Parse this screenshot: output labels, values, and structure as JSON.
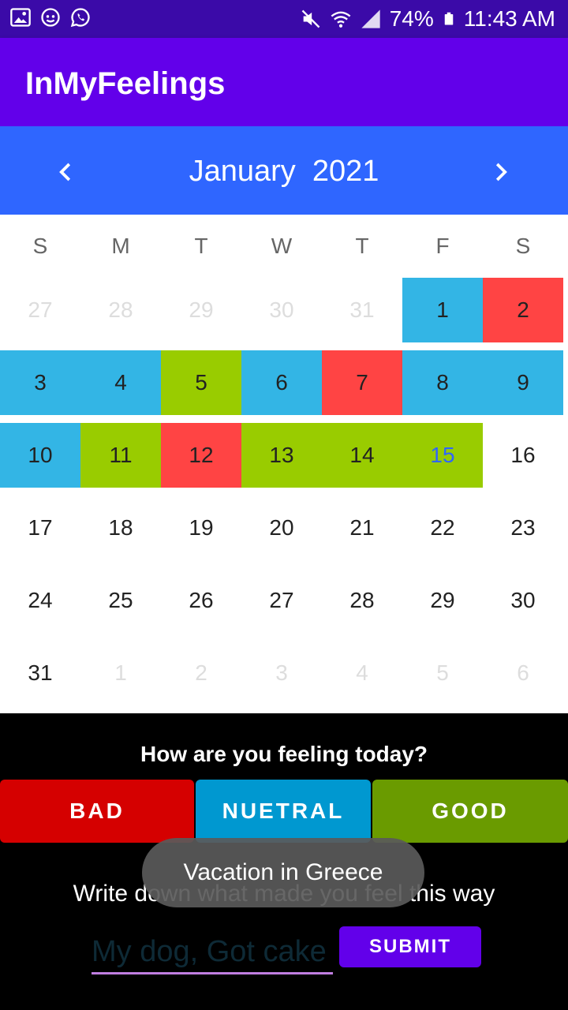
{
  "status_bar": {
    "left_icons": [
      "image-icon",
      "face-icon",
      "whatsapp-icon"
    ],
    "right_icons": [
      "mute-icon",
      "wifi-icon",
      "signal-icon",
      "battery-icon"
    ],
    "battery": "74%",
    "time": "11:43 AM"
  },
  "app_bar": {
    "title": "InMyFeelings"
  },
  "calendar": {
    "month_year": "January  2021",
    "weekdays": [
      "S",
      "M",
      "T",
      "W",
      "T",
      "F",
      "S"
    ],
    "mood_colors": {
      "bad": "#ff4444",
      "neutral": "#33b5e5",
      "good": "#99cc00",
      "today_text": "#2f66ff"
    },
    "days": [
      {
        "label": "27",
        "in_month": false
      },
      {
        "label": "28",
        "in_month": false
      },
      {
        "label": "29",
        "in_month": false
      },
      {
        "label": "30",
        "in_month": false
      },
      {
        "label": "31",
        "in_month": false
      },
      {
        "label": "1",
        "in_month": true,
        "mood": "neutral"
      },
      {
        "label": "2",
        "in_month": true,
        "mood": "bad"
      },
      {
        "label": "3",
        "in_month": true,
        "mood": "neutral"
      },
      {
        "label": "4",
        "in_month": true,
        "mood": "neutral"
      },
      {
        "label": "5",
        "in_month": true,
        "mood": "good"
      },
      {
        "label": "6",
        "in_month": true,
        "mood": "neutral"
      },
      {
        "label": "7",
        "in_month": true,
        "mood": "bad"
      },
      {
        "label": "8",
        "in_month": true,
        "mood": "neutral"
      },
      {
        "label": "9",
        "in_month": true,
        "mood": "neutral"
      },
      {
        "label": "10",
        "in_month": true,
        "mood": "neutral"
      },
      {
        "label": "11",
        "in_month": true,
        "mood": "good"
      },
      {
        "label": "12",
        "in_month": true,
        "mood": "bad"
      },
      {
        "label": "13",
        "in_month": true,
        "mood": "good"
      },
      {
        "label": "14",
        "in_month": true,
        "mood": "good"
      },
      {
        "label": "15",
        "in_month": true,
        "mood": "good",
        "today": true
      },
      {
        "label": "16",
        "in_month": true
      },
      {
        "label": "17",
        "in_month": true
      },
      {
        "label": "18",
        "in_month": true
      },
      {
        "label": "19",
        "in_month": true
      },
      {
        "label": "20",
        "in_month": true
      },
      {
        "label": "21",
        "in_month": true
      },
      {
        "label": "22",
        "in_month": true
      },
      {
        "label": "23",
        "in_month": true
      },
      {
        "label": "24",
        "in_month": true
      },
      {
        "label": "25",
        "in_month": true
      },
      {
        "label": "26",
        "in_month": true
      },
      {
        "label": "27",
        "in_month": true
      },
      {
        "label": "28",
        "in_month": true
      },
      {
        "label": "29",
        "in_month": true
      },
      {
        "label": "30",
        "in_month": true
      },
      {
        "label": "31",
        "in_month": true
      },
      {
        "label": "1",
        "in_month": false
      },
      {
        "label": "2",
        "in_month": false
      },
      {
        "label": "3",
        "in_month": false
      },
      {
        "label": "4",
        "in_month": false
      },
      {
        "label": "5",
        "in_month": false
      },
      {
        "label": "6",
        "in_month": false
      }
    ]
  },
  "mood_panel": {
    "question": "How are you feeling today?",
    "buttons": {
      "bad": "BAD",
      "neutral": "NUETRAL",
      "good": "GOOD"
    },
    "button_colors": {
      "bad": "#d50000",
      "neutral": "#0098d0",
      "good": "#6a9b00"
    },
    "prompt": "Write down what made you feel this way",
    "entry_value": "My dog, Got cake",
    "submit_label": "SUBMIT"
  },
  "toast": {
    "text": "Vacation in Greece"
  }
}
